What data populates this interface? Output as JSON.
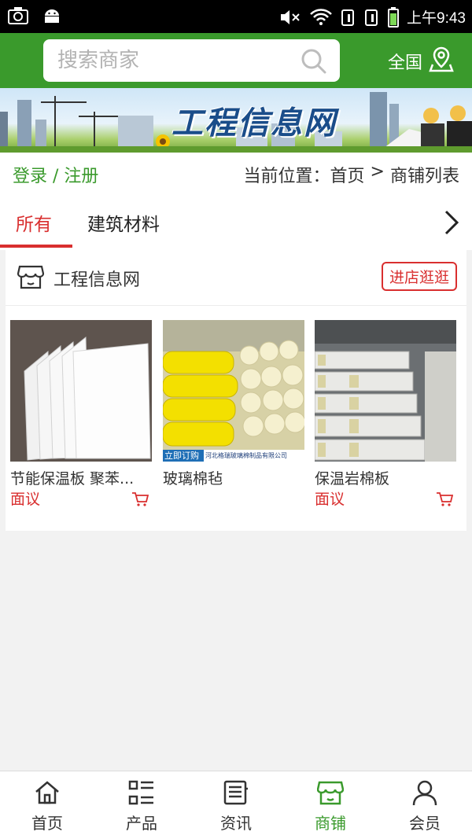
{
  "statusbar": {
    "time": "上午9:43"
  },
  "header": {
    "search_placeholder": "搜索商家",
    "region_label": "全国"
  },
  "banner": {
    "title": "工程信息网"
  },
  "crumbbar": {
    "login_label": "登录 / 注册",
    "location_prefix": "当前位置：",
    "home": "首页",
    "separator": " > ",
    "current": "商铺列表"
  },
  "tabs": [
    {
      "label": "所有",
      "active": true
    },
    {
      "label": "建筑材料",
      "active": false
    }
  ],
  "shop": {
    "name": "工程信息网",
    "visit_label": "进店逛逛",
    "products": [
      {
        "name": "节能保温板 聚苯...",
        "price": "面议"
      },
      {
        "name": "玻璃棉毡",
        "price": "面议",
        "image_text": [
          "立即订购",
          "河北格瑞玻璃棉制品有限公司"
        ]
      },
      {
        "name": "保温岩棉板",
        "price": "面议"
      }
    ]
  },
  "bottomnav": [
    {
      "label": "首页",
      "icon": "home-icon",
      "active": false
    },
    {
      "label": "产品",
      "icon": "list-icon",
      "active": false
    },
    {
      "label": "资讯",
      "icon": "news-icon",
      "active": false
    },
    {
      "label": "商铺",
      "icon": "store-icon",
      "active": true
    },
    {
      "label": "会员",
      "icon": "user-icon",
      "active": false
    }
  ],
  "colors": {
    "brand_green": "#3a9a2c",
    "accent_red": "#d92f2f"
  }
}
